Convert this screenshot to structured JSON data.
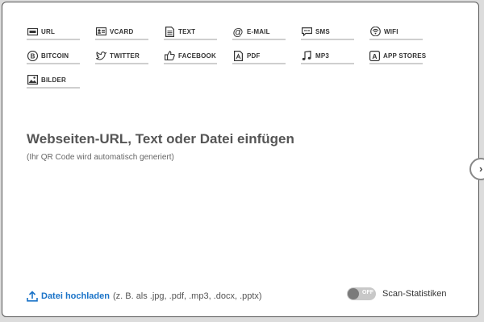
{
  "tabs": [
    {
      "label": "URL",
      "icon": "url-icon"
    },
    {
      "label": "VCARD",
      "icon": "vcard-icon"
    },
    {
      "label": "TEXT",
      "icon": "text-icon"
    },
    {
      "label": "E-MAIL",
      "icon": "email-icon"
    },
    {
      "label": "SMS",
      "icon": "sms-icon"
    },
    {
      "label": "WIFI",
      "icon": "wifi-icon"
    },
    {
      "label": "BITCOIN",
      "icon": "bitcoin-icon"
    },
    {
      "label": "TWITTER",
      "icon": "twitter-icon"
    },
    {
      "label": "FACEBOOK",
      "icon": "facebook-icon"
    },
    {
      "label": "PDF",
      "icon": "pdf-icon"
    },
    {
      "label": "MP3",
      "icon": "mp3-icon"
    },
    {
      "label": "APP STORES",
      "icon": "app-stores-icon"
    },
    {
      "label": "BILDER",
      "icon": "bilder-icon"
    }
  ],
  "main": {
    "headline": "Webseiten-URL, Text oder Datei einfügen",
    "subline": "(Ihr QR Code wird automatisch generiert)"
  },
  "upload": {
    "link_label": "Datei hochladen",
    "hint": "(z. B. als .jpg, .pdf, .mp3, .docx, .pptx)"
  },
  "scan_stats": {
    "toggle_state": "OFF",
    "label": "Scan-Statistiken"
  },
  "colors": {
    "link": "#1a73c8",
    "headline": "#555555"
  }
}
